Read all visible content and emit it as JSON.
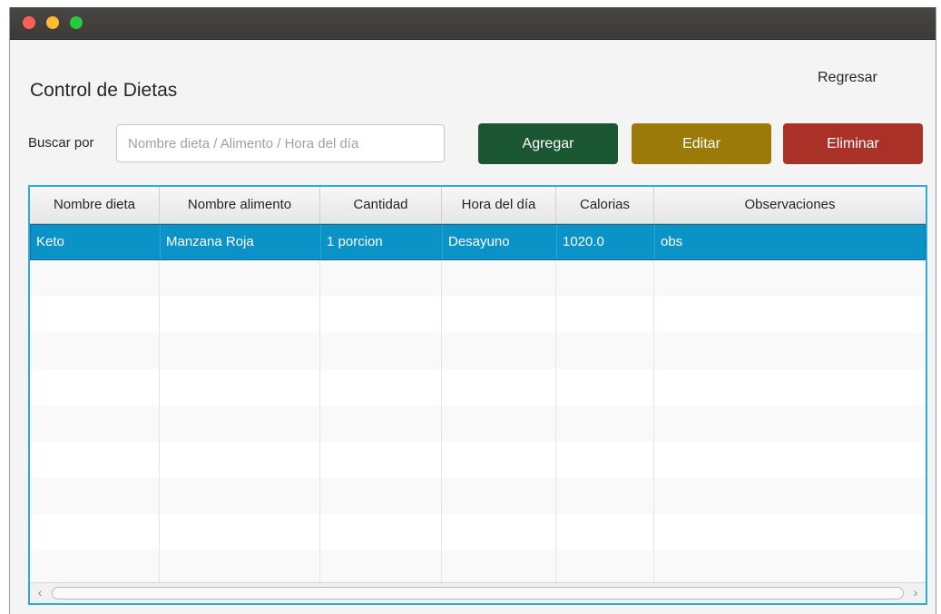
{
  "window": {
    "title_bar_colors": {
      "close": "#ff5f57",
      "minimize": "#febc2e",
      "maximize": "#28c840"
    }
  },
  "header": {
    "title": "Control de Dietas",
    "back_link": "Regresar"
  },
  "search": {
    "label": "Buscar por",
    "placeholder": "Nombre dieta / Alimento / Hora del día",
    "value": ""
  },
  "toolbar": {
    "add_label": "Agregar",
    "edit_label": "Editar",
    "delete_label": "Eliminar",
    "colors": {
      "add": "#1b5632",
      "edit": "#9b7a0a",
      "delete": "#aa3127"
    }
  },
  "table": {
    "columns": [
      "Nombre dieta",
      "Nombre alimento",
      "Cantidad",
      "Hora del día",
      "Calorias",
      "Observaciones"
    ],
    "rows": [
      [
        "Keto",
        "Manzana Roja",
        "1 porcion",
        "Desayuno",
        "1020.0",
        "obs"
      ]
    ],
    "selected_row": 0,
    "selection_color": "#0b93c8",
    "empty_rows": 9
  }
}
